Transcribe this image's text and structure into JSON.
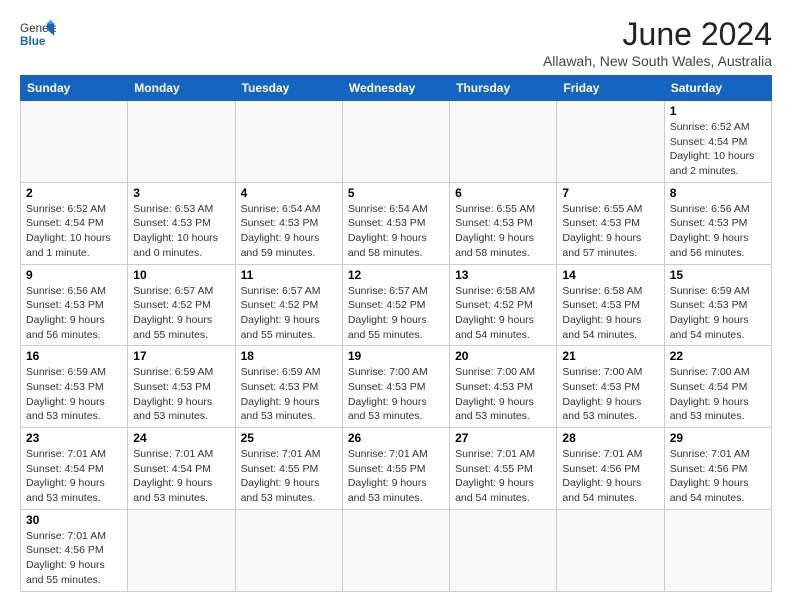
{
  "header": {
    "logo_general": "General",
    "logo_blue": "Blue",
    "title": "June 2024",
    "subtitle": "Allawah, New South Wales, Australia"
  },
  "days_of_week": [
    "Sunday",
    "Monday",
    "Tuesday",
    "Wednesday",
    "Thursday",
    "Friday",
    "Saturday"
  ],
  "weeks": [
    [
      {
        "day": "",
        "info": ""
      },
      {
        "day": "",
        "info": ""
      },
      {
        "day": "",
        "info": ""
      },
      {
        "day": "",
        "info": ""
      },
      {
        "day": "",
        "info": ""
      },
      {
        "day": "",
        "info": ""
      },
      {
        "day": "1",
        "info": "Sunrise: 6:52 AM\nSunset: 4:54 PM\nDaylight: 10 hours\nand 2 minutes."
      }
    ],
    [
      {
        "day": "2",
        "info": "Sunrise: 6:52 AM\nSunset: 4:54 PM\nDaylight: 10 hours\nand 1 minute."
      },
      {
        "day": "3",
        "info": "Sunrise: 6:53 AM\nSunset: 4:53 PM\nDaylight: 10 hours\nand 0 minutes."
      },
      {
        "day": "4",
        "info": "Sunrise: 6:54 AM\nSunset: 4:53 PM\nDaylight: 9 hours\nand 59 minutes."
      },
      {
        "day": "5",
        "info": "Sunrise: 6:54 AM\nSunset: 4:53 PM\nDaylight: 9 hours\nand 58 minutes."
      },
      {
        "day": "6",
        "info": "Sunrise: 6:55 AM\nSunset: 4:53 PM\nDaylight: 9 hours\nand 58 minutes."
      },
      {
        "day": "7",
        "info": "Sunrise: 6:55 AM\nSunset: 4:53 PM\nDaylight: 9 hours\nand 57 minutes."
      },
      {
        "day": "8",
        "info": "Sunrise: 6:56 AM\nSunset: 4:53 PM\nDaylight: 9 hours\nand 56 minutes."
      }
    ],
    [
      {
        "day": "9",
        "info": "Sunrise: 6:56 AM\nSunset: 4:53 PM\nDaylight: 9 hours\nand 56 minutes."
      },
      {
        "day": "10",
        "info": "Sunrise: 6:57 AM\nSunset: 4:52 PM\nDaylight: 9 hours\nand 55 minutes."
      },
      {
        "day": "11",
        "info": "Sunrise: 6:57 AM\nSunset: 4:52 PM\nDaylight: 9 hours\nand 55 minutes."
      },
      {
        "day": "12",
        "info": "Sunrise: 6:57 AM\nSunset: 4:52 PM\nDaylight: 9 hours\nand 55 minutes."
      },
      {
        "day": "13",
        "info": "Sunrise: 6:58 AM\nSunset: 4:52 PM\nDaylight: 9 hours\nand 54 minutes."
      },
      {
        "day": "14",
        "info": "Sunrise: 6:58 AM\nSunset: 4:53 PM\nDaylight: 9 hours\nand 54 minutes."
      },
      {
        "day": "15",
        "info": "Sunrise: 6:59 AM\nSunset: 4:53 PM\nDaylight: 9 hours\nand 54 minutes."
      }
    ],
    [
      {
        "day": "16",
        "info": "Sunrise: 6:59 AM\nSunset: 4:53 PM\nDaylight: 9 hours\nand 53 minutes."
      },
      {
        "day": "17",
        "info": "Sunrise: 6:59 AM\nSunset: 4:53 PM\nDaylight: 9 hours\nand 53 minutes."
      },
      {
        "day": "18",
        "info": "Sunrise: 6:59 AM\nSunset: 4:53 PM\nDaylight: 9 hours\nand 53 minutes."
      },
      {
        "day": "19",
        "info": "Sunrise: 7:00 AM\nSunset: 4:53 PM\nDaylight: 9 hours\nand 53 minutes."
      },
      {
        "day": "20",
        "info": "Sunrise: 7:00 AM\nSunset: 4:53 PM\nDaylight: 9 hours\nand 53 minutes."
      },
      {
        "day": "21",
        "info": "Sunrise: 7:00 AM\nSunset: 4:53 PM\nDaylight: 9 hours\nand 53 minutes."
      },
      {
        "day": "22",
        "info": "Sunrise: 7:00 AM\nSunset: 4:54 PM\nDaylight: 9 hours\nand 53 minutes."
      }
    ],
    [
      {
        "day": "23",
        "info": "Sunrise: 7:01 AM\nSunset: 4:54 PM\nDaylight: 9 hours\nand 53 minutes."
      },
      {
        "day": "24",
        "info": "Sunrise: 7:01 AM\nSunset: 4:54 PM\nDaylight: 9 hours\nand 53 minutes."
      },
      {
        "day": "25",
        "info": "Sunrise: 7:01 AM\nSunset: 4:55 PM\nDaylight: 9 hours\nand 53 minutes."
      },
      {
        "day": "26",
        "info": "Sunrise: 7:01 AM\nSunset: 4:55 PM\nDaylight: 9 hours\nand 53 minutes."
      },
      {
        "day": "27",
        "info": "Sunrise: 7:01 AM\nSunset: 4:55 PM\nDaylight: 9 hours\nand 54 minutes."
      },
      {
        "day": "28",
        "info": "Sunrise: 7:01 AM\nSunset: 4:56 PM\nDaylight: 9 hours\nand 54 minutes."
      },
      {
        "day": "29",
        "info": "Sunrise: 7:01 AM\nSunset: 4:56 PM\nDaylight: 9 hours\nand 54 minutes."
      }
    ],
    [
      {
        "day": "30",
        "info": "Sunrise: 7:01 AM\nSunset: 4:56 PM\nDaylight: 9 hours\nand 55 minutes."
      },
      {
        "day": "",
        "info": ""
      },
      {
        "day": "",
        "info": ""
      },
      {
        "day": "",
        "info": ""
      },
      {
        "day": "",
        "info": ""
      },
      {
        "day": "",
        "info": ""
      },
      {
        "day": "",
        "info": ""
      }
    ]
  ]
}
